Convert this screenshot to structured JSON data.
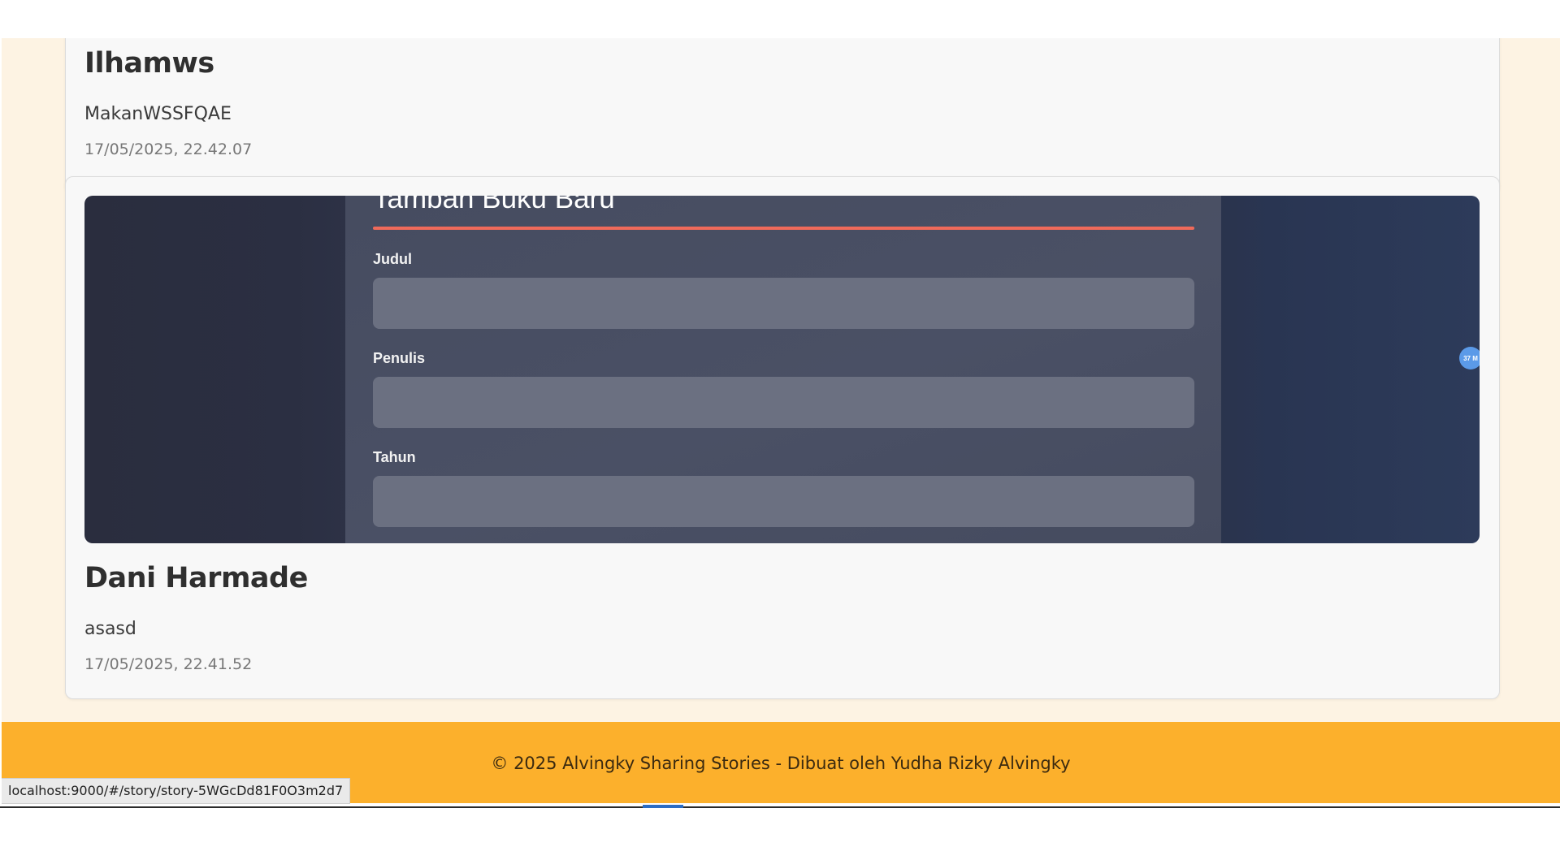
{
  "stories": [
    {
      "name": "Ilhamws",
      "description": "MakanWSSFQAE",
      "date": "17/05/2025, 22.42.07"
    },
    {
      "name": "Dani Harmade",
      "description": "asasd",
      "date": "17/05/2025, 22.41.52",
      "photo": {
        "title": "Tambah Buku Baru",
        "fields": [
          "Judul",
          "Penulis",
          "Tahun"
        ],
        "badge": "37 M"
      }
    }
  ],
  "footer": {
    "text": "© 2025 Alvingky Sharing Stories - Dibuat oleh Yudha Rizky Alvingky"
  },
  "status_bar": {
    "url": "localhost:9000/#/story/story-5WGcDd81F0O3m2d7"
  },
  "colors": {
    "page_background": "#fdf3e3",
    "card_background": "#f8f8f8",
    "footer_background": "#fcb02c",
    "accent_rule": "#f06a5a"
  }
}
